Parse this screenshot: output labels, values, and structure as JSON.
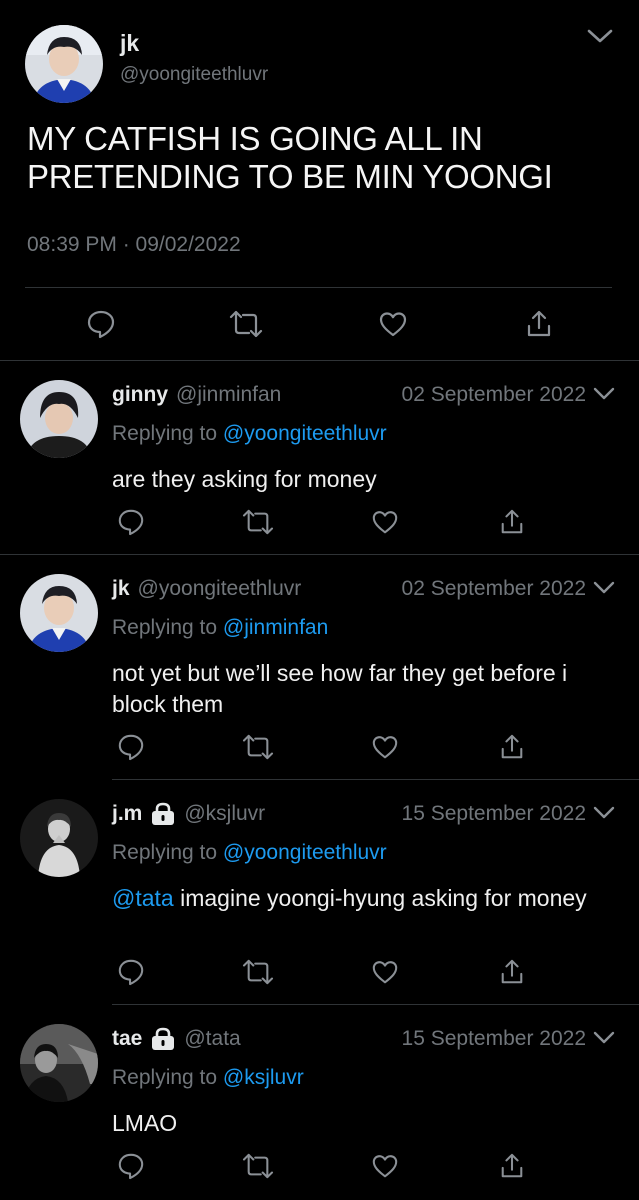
{
  "main_tweet": {
    "author_name": "jk",
    "author_handle": "@yoongiteethluvr",
    "text": "MY CATFISH IS GOING ALL IN PRETENDING TO BE MIN YOONGI",
    "timestamp": "08:39 PM · 09/02/2022",
    "avatar_icon": "avatar-photo-blue-jacket"
  },
  "replies": [
    {
      "name": "ginny",
      "handle": "@jinminfan",
      "locked": false,
      "date": "02 September 2022",
      "replying_prefix": "Replying to",
      "replying_to": "@yoongiteethluvr",
      "mention": "",
      "text": "are they asking for money"
    },
    {
      "name": "jk",
      "handle": "@yoongiteethluvr",
      "locked": false,
      "date": "02 September 2022",
      "replying_prefix": "Replying to",
      "replying_to": "@jinminfan",
      "mention": "",
      "text": "not yet but we’ll see how far they get before i block them"
    },
    {
      "name": "j.m",
      "handle": "@ksjluvr",
      "locked": true,
      "date": "15 September 2022",
      "replying_prefix": "Replying to",
      "replying_to": "@yoongiteethluvr",
      "mention": "@tata",
      "text": " imagine yoongi-hyung asking for money"
    },
    {
      "name": "tae",
      "handle": "@tata",
      "locked": true,
      "date": "15 September 2022",
      "replying_prefix": "Replying to",
      "replying_to": "@ksjluvr",
      "mention": "",
      "text": "LMAO"
    }
  ],
  "colors": {
    "background": "#000000",
    "text": "#e7e9ea",
    "muted": "#71767b",
    "link": "#1d9bf0",
    "divider": "#2f3336"
  },
  "icons": [
    "reply-icon",
    "retweet-icon",
    "like-icon",
    "share-icon",
    "chevron-down-icon",
    "lock-icon"
  ]
}
